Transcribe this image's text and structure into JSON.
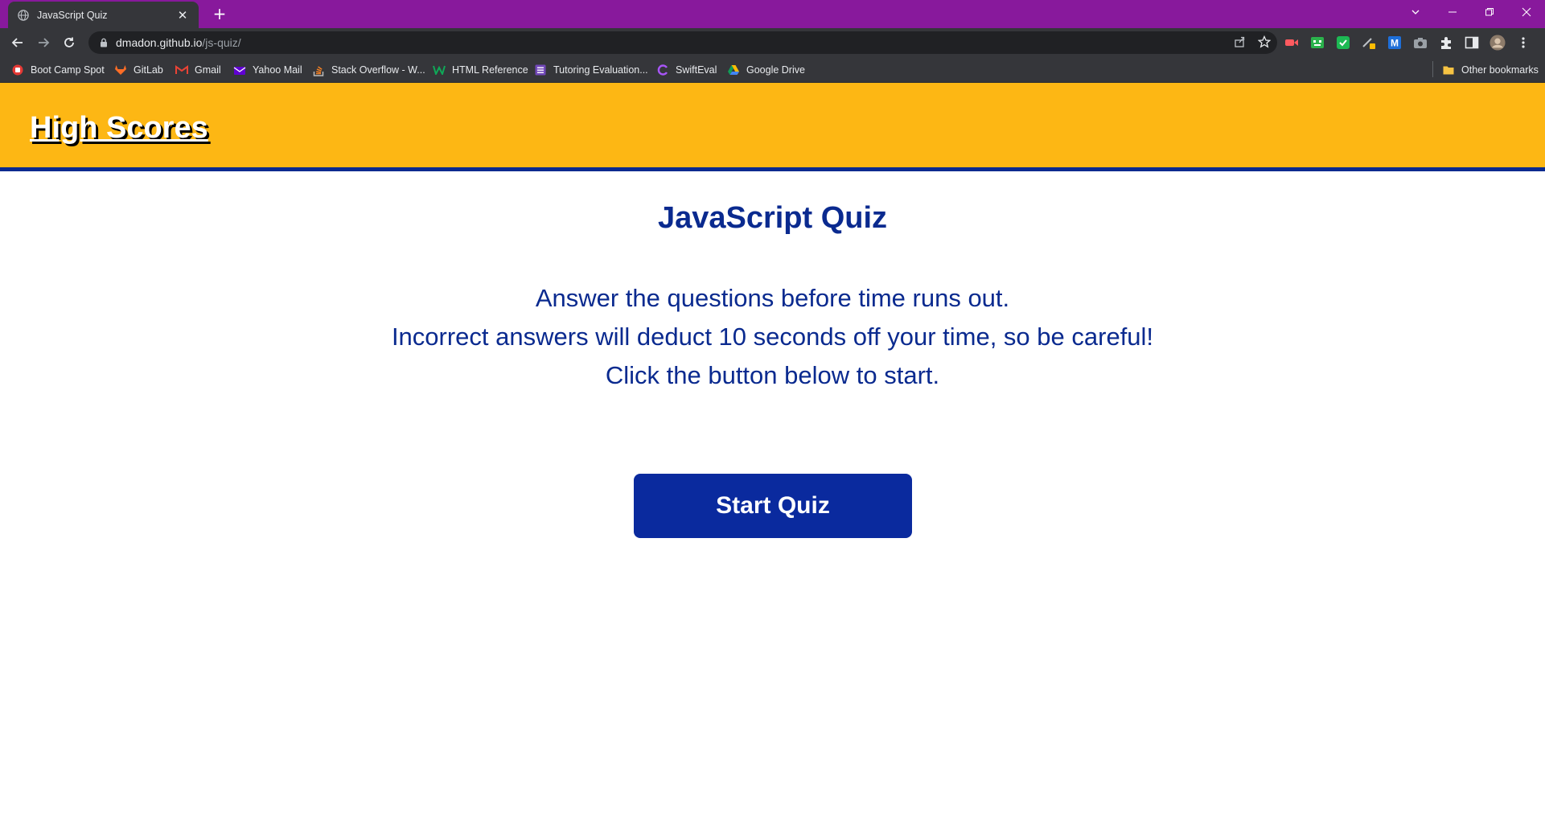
{
  "browser": {
    "tab": {
      "title": "JavaScript Quiz"
    },
    "address": {
      "host": "dmadon.github.io",
      "path": "/js-quiz/"
    },
    "bookmarks": [
      {
        "label": "Boot Camp Spot",
        "icon": "bootcamp-icon",
        "color": "#e53935"
      },
      {
        "label": "GitLab",
        "icon": "gitlab-icon",
        "color": "#fc6d26"
      },
      {
        "label": "Gmail",
        "icon": "gmail-icon",
        "color": "#ea4335"
      },
      {
        "label": "Yahoo Mail",
        "icon": "yahoo-icon",
        "color": "#6001d2"
      },
      {
        "label": "Stack Overflow - W...",
        "icon": "stackoverflow-icon",
        "color": "#f48024"
      },
      {
        "label": "HTML Reference",
        "icon": "html-reference-icon",
        "color": "#0fa958"
      },
      {
        "label": "Tutoring Evaluation...",
        "icon": "form-icon",
        "color": "#7248b9"
      },
      {
        "label": "SwiftEval",
        "icon": "swifteval-icon",
        "color": "#a855f7"
      },
      {
        "label": "Google Drive",
        "icon": "google-drive-icon",
        "color": "#34a853"
      }
    ],
    "other_bookmarks": "Other bookmarks"
  },
  "page": {
    "header": {
      "high_scores_label": "High Scores"
    },
    "title": "JavaScript Quiz",
    "instructions": [
      "Answer the questions before time runs out.",
      "Incorrect answers will deduct 10 seconds off your time, so be careful!",
      "Click the button below to start."
    ],
    "start_button": "Start Quiz"
  },
  "colors": {
    "header_bg": "#fdb714",
    "accent_blue": "#0a2a8f",
    "button_bg": "#0a2a9e",
    "tabstrip_bg": "#88199c"
  }
}
